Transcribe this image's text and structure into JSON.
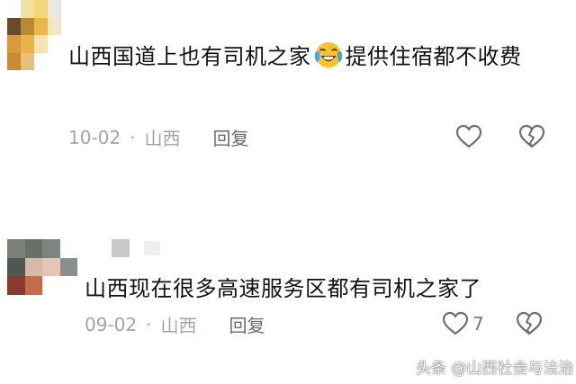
{
  "comments": [
    {
      "text_before": "山西国道上也有司机之家",
      "emoji": "laugh-cry-emoji",
      "text_after": "提供住宿都不收费",
      "date": "10-02",
      "separator": "·",
      "location": "山西",
      "reply_label": "回复",
      "like_count": ""
    },
    {
      "text": "山西现在很多高速服务区都有司机之家了",
      "date": "09-02",
      "separator": "·",
      "location": "山西",
      "reply_label": "回复",
      "like_count": "7"
    }
  ],
  "watermark": "头条 @山西社会与法治",
  "colors": {
    "text": "#111111",
    "meta": "#a4a4a4",
    "reply": "#6b6b6b",
    "icon": "#6f6f6f"
  },
  "avatars": {
    "avatar1": [
      "#ffffff",
      "#f2e0a0",
      "#f5d67a",
      "#e8e8e8",
      "#6b4a2a",
      "#b98a2e",
      "#e8b94a",
      "#f0e6c8",
      "#d99a3a",
      "#e9b24a",
      "#f5e3b0",
      "#ffffff",
      "#c78b35",
      "#e7c17a",
      "#ffffff",
      "#ffffff"
    ],
    "avatar2": [
      "#7a8078",
      "#6a6f6a",
      "#7e8580",
      "#ffffff",
      "#4f5751",
      "#d8b9a8",
      "#e3c6b6",
      "#8a8f88",
      "#8a3a2a",
      "#c56a4a",
      "#ffffff",
      "#ffffff"
    ]
  }
}
